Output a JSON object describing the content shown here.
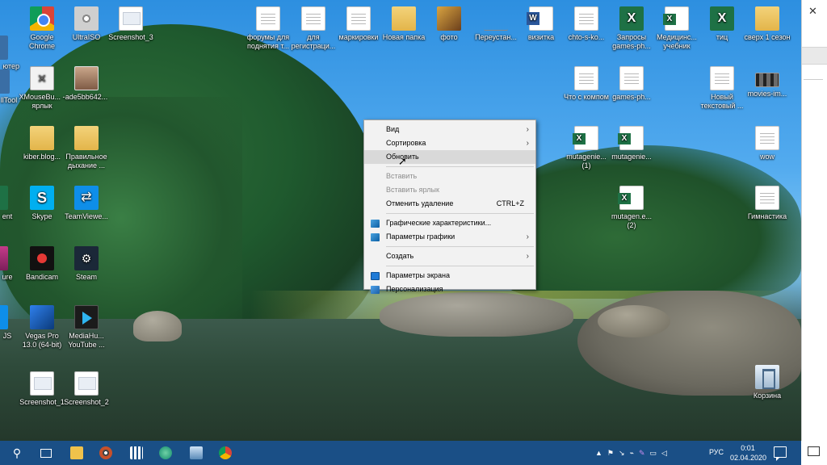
{
  "desktop": {
    "icons": [
      {
        "label": "Google Chrome",
        "icon": "chrome-icon"
      },
      {
        "label": "UltraISO",
        "icon": "disc-icon"
      },
      {
        "label": "Screenshot_3",
        "icon": "screenshot-icon"
      },
      {
        "label": "XMouseBu... - ярлык",
        "icon": "xmouse-icon"
      },
      {
        "label": "ade5bb642...",
        "icon": "photo-icon"
      },
      {
        "label": "kiber.blog...",
        "icon": "folder-icon"
      },
      {
        "label": "Правильное дыхание ...",
        "icon": "archive-icon"
      },
      {
        "label": "Skype",
        "icon": "skype-icon"
      },
      {
        "label": "TeamViewe...",
        "icon": "teamviewer-icon"
      },
      {
        "label": "Bandicam",
        "icon": "bandicam-icon"
      },
      {
        "label": "Steam",
        "icon": "steam-icon"
      },
      {
        "label": "Vegas Pro 13.0 (64-bit)",
        "icon": "vegas-icon"
      },
      {
        "label": "MediaHu... YouTube ...",
        "icon": "mediahuman-icon"
      },
      {
        "label": "Screenshot_1",
        "icon": "screenshot-icon"
      },
      {
        "label": "Screenshot_2",
        "icon": "screenshot-icon"
      },
      {
        "label": "форумы для поднятия т...",
        "icon": "document-icon"
      },
      {
        "label": "для регистраци...",
        "icon": "document-icon"
      },
      {
        "label": "маркировки",
        "icon": "document-icon"
      },
      {
        "label": "Новая папка",
        "icon": "folder-icon"
      },
      {
        "label": "фото",
        "icon": "photo-folder-icon"
      },
      {
        "label": "Переустан...",
        "icon": "shortcut-icon"
      },
      {
        "label": "визитка",
        "icon": "word-icon"
      },
      {
        "label": "chto-s-ko...",
        "icon": "document-icon"
      },
      {
        "label": "Запросы games-ph...",
        "icon": "excel-icon"
      },
      {
        "label": "Медицинс... учебник",
        "icon": "excel-doc-icon"
      },
      {
        "label": "тиц",
        "icon": "excel-icon"
      },
      {
        "label": "сверх 1 сезон",
        "icon": "folder-icon"
      },
      {
        "label": "Что с компом",
        "icon": "document-icon"
      },
      {
        "label": "games-ph...",
        "icon": "document-icon"
      },
      {
        "label": "Новый текстовый ...",
        "icon": "document-icon"
      },
      {
        "label": "movies-im...",
        "icon": "film-icon"
      },
      {
        "label": "mutagenie... (1)",
        "icon": "excel-doc-icon"
      },
      {
        "label": "mutagenie...",
        "icon": "excel-doc-icon"
      },
      {
        "label": "wow",
        "icon": "document-icon"
      },
      {
        "label": "mutagen.e... (2)",
        "icon": "excel-doc-icon"
      },
      {
        "label": "Гимнастика",
        "icon": "document-icon"
      },
      {
        "label": "Корзина",
        "icon": "recycle-bin-icon"
      }
    ],
    "left_edge_labels": [
      "ютер",
      "llTool",
      "ent",
      "ure",
      "ion",
      "JS"
    ]
  },
  "context_menu": {
    "items": [
      {
        "label": "Вид",
        "submenu": true,
        "disabled": false
      },
      {
        "label": "Сортировка",
        "submenu": true,
        "disabled": false
      },
      {
        "label": "Обновить",
        "submenu": false,
        "disabled": false,
        "highlighted": true
      },
      {
        "label": "Вставить",
        "submenu": false,
        "disabled": true
      },
      {
        "label": "Вставить ярлык",
        "submenu": false,
        "disabled": true
      },
      {
        "label": "Отменить удаление",
        "shortcut": "CTRL+Z",
        "submenu": false,
        "disabled": false
      },
      {
        "label": "Графические характеристики...",
        "submenu": false,
        "disabled": false,
        "icon": "intel-graphics-icon"
      },
      {
        "label": "Параметры графики",
        "submenu": true,
        "disabled": false,
        "icon": "intel-graphics-icon"
      },
      {
        "label": "Создать",
        "submenu": true,
        "disabled": false
      },
      {
        "label": "Параметры экрана",
        "submenu": false,
        "disabled": false,
        "icon": "display-icon"
      },
      {
        "label": "Персонализация",
        "submenu": false,
        "disabled": false,
        "icon": "personalize-icon"
      }
    ]
  },
  "taskbar": {
    "buttons": [
      "search-icon",
      "task-view-icon",
      "file-explorer-icon",
      "media-player-icon",
      "calculator-icon",
      "browser-icon",
      "network-app-icon",
      "chrome-icon"
    ],
    "tray_icons": [
      "dropbox-icon",
      "network-icon",
      "arrow-icon",
      "usb-icon",
      "feather-icon",
      "volume-icon",
      "battery-icon"
    ],
    "language": "РУС",
    "time": "0:01",
    "date": "02.04.2020"
  },
  "colors": {
    "taskbar": "#1a4f86",
    "menu_bg": "#f2f2f2",
    "menu_hover": "#d9d9d9",
    "disabled_text": "#8d8d8d"
  }
}
